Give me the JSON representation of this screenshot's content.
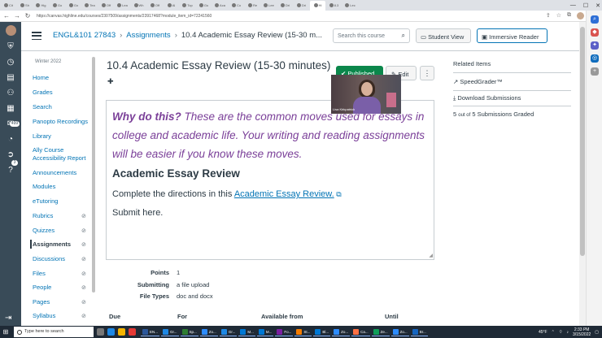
{
  "browser": {
    "tabs": [
      "Cit",
      "Sh",
      "Hig",
      "Go",
      "Go",
      "Tea",
      "Off",
      "Lea",
      "Wh",
      "Off",
      "Al",
      "Top",
      "Gu",
      "Aca",
      "Co",
      "Re",
      "Lee",
      "Dri",
      "Dri",
      "Hi",
      "8.3",
      "Lec"
    ],
    "url": "https://canvas.highline.edu/courses/2307509/assignments/23917468?module_item_id=72241560"
  },
  "global_nav": {
    "items": [
      "account-icon",
      "dashboard-icon",
      "courses-icon",
      "groups-icon",
      "calendar-icon",
      "inbox-icon",
      "history-icon",
      "commons-icon",
      "help-icon"
    ],
    "inbox_badge": "499",
    "help_badge": "3"
  },
  "header": {
    "course": "ENGL&101 27843",
    "section": "Assignments",
    "page": "10.4 Academic Essay Review (15-30 m...",
    "search_placeholder": "Search this course",
    "student_view": "Student View",
    "immersive_reader": "Immersive Reader"
  },
  "course_nav": {
    "term": "Winter 2022",
    "items": [
      {
        "label": "Home",
        "hidden": false
      },
      {
        "label": "Grades",
        "hidden": false
      },
      {
        "label": "Search",
        "hidden": false
      },
      {
        "label": "Panopto Recordings",
        "hidden": false
      },
      {
        "label": "Library",
        "hidden": false
      },
      {
        "label": "Ally Course Accessibility Report",
        "hidden": false
      },
      {
        "label": "Announcements",
        "hidden": false
      },
      {
        "label": "Modules",
        "hidden": false
      },
      {
        "label": "eTutoring",
        "hidden": false
      },
      {
        "label": "Rubrics",
        "hidden": true
      },
      {
        "label": "Quizzes",
        "hidden": true
      },
      {
        "label": "Assignments",
        "hidden": true
      },
      {
        "label": "Discussions",
        "hidden": true
      },
      {
        "label": "Files",
        "hidden": true
      },
      {
        "label": "People",
        "hidden": true
      },
      {
        "label": "Pages",
        "hidden": true
      },
      {
        "label": "Syllabus",
        "hidden": true
      }
    ],
    "active": "Assignments"
  },
  "assignment": {
    "title": "10.4 Academic Essay Review (15-30 minutes)",
    "published": "Published",
    "edit": "Edit",
    "why_bold": "Why do this?",
    "why_text": " These are the common moves used for essays in college and academic life. Your writing and reading assignments will be easier if you know these moves.",
    "heading": "Academic Essay Review",
    "directions_prefix": "Complete the directions in this ",
    "directions_link": "Academic Essay Review.",
    "submit": "Submit here.",
    "details": [
      {
        "label": "Points",
        "value": "1"
      },
      {
        "label": "Submitting",
        "value": "a file upload"
      },
      {
        "label": "File Types",
        "value": "doc and docx"
      }
    ],
    "due_headers": [
      "Due",
      "For",
      "Available from",
      "Until"
    ]
  },
  "sidebar": {
    "heading": "Related Items",
    "speedgrader": "SpeedGrader™",
    "download": "Download Submissions",
    "graded_count": "5",
    "graded_out_of": "out of",
    "graded_text": "5 Submissions Graded"
  },
  "webcam": {
    "caption": "Lisa Kirkpatrick"
  },
  "taskbar": {
    "search_placeholder": "Type here to search",
    "apps": [
      "EN...",
      "Gr...",
      "Sp...",
      "Zo...",
      "Gr...",
      "M...",
      "M...",
      "Fo...",
      "St...",
      "Bl...",
      "Zo...",
      "Ca...",
      "Ze...",
      "Zo...",
      "Br..."
    ],
    "weather": "45°F",
    "time": "2:33 PM",
    "date": "3/15/2022"
  },
  "colors": {
    "canvas_nav": "#394b58",
    "link": "#0374b5",
    "published": "#0b874b",
    "why": "#7b4099"
  }
}
